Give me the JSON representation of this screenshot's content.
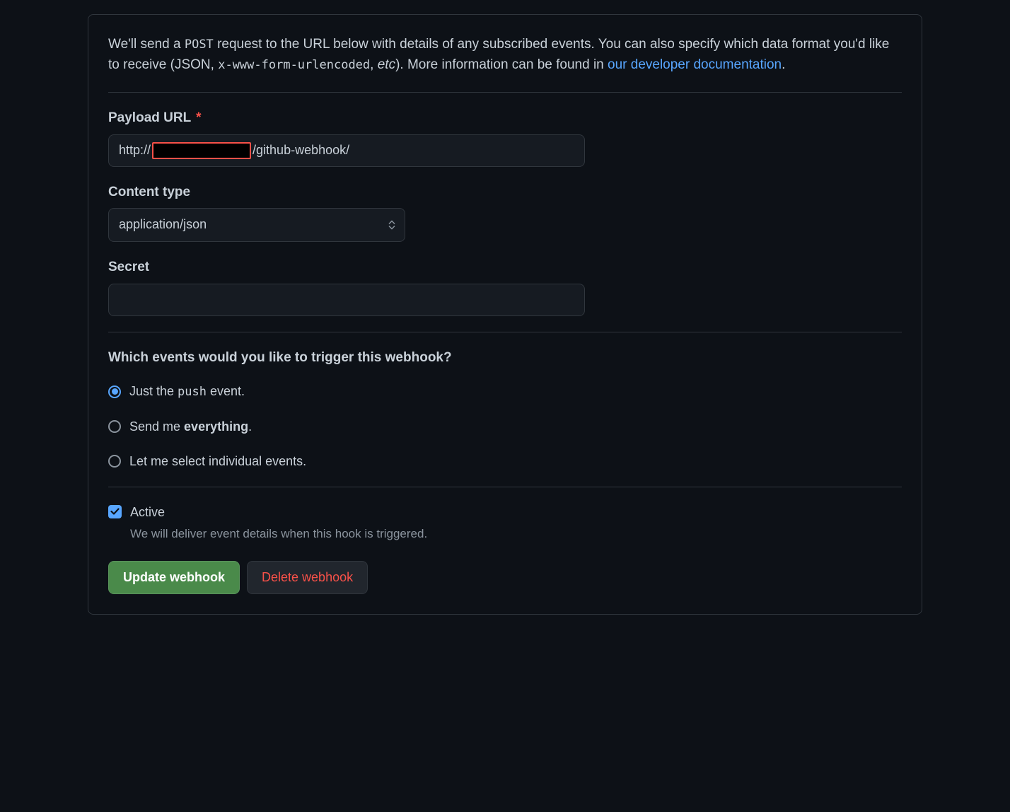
{
  "description": {
    "part1": "We'll send a ",
    "code1": "POST",
    "part2": " request to the URL below with details of any subscribed events. You can also specify which data format you'd like to receive (JSON, ",
    "code2": "x-www-form-urlencoded",
    "part3": ", ",
    "em": "etc",
    "part4": "). More information can be found in ",
    "link_text": "our developer documentation",
    "part5": "."
  },
  "form": {
    "payload_url": {
      "label": "Payload URL",
      "required": "*",
      "value_prefix": "http://",
      "value_suffix": "/github-webhook/"
    },
    "content_type": {
      "label": "Content type",
      "selected": "application/json"
    },
    "secret": {
      "label": "Secret",
      "value": ""
    }
  },
  "events": {
    "heading": "Which events would you like to trigger this webhook?",
    "options": {
      "push": {
        "prefix": "Just the ",
        "code": "push",
        "suffix": " event.",
        "selected": true
      },
      "everything": {
        "prefix": "Send me ",
        "strong": "everything",
        "suffix": ".",
        "selected": false
      },
      "individual": {
        "text": "Let me select individual events.",
        "selected": false
      }
    }
  },
  "active": {
    "label": "Active",
    "help": "We will deliver event details when this hook is triggered.",
    "checked": true
  },
  "buttons": {
    "update": "Update webhook",
    "delete": "Delete webhook"
  }
}
